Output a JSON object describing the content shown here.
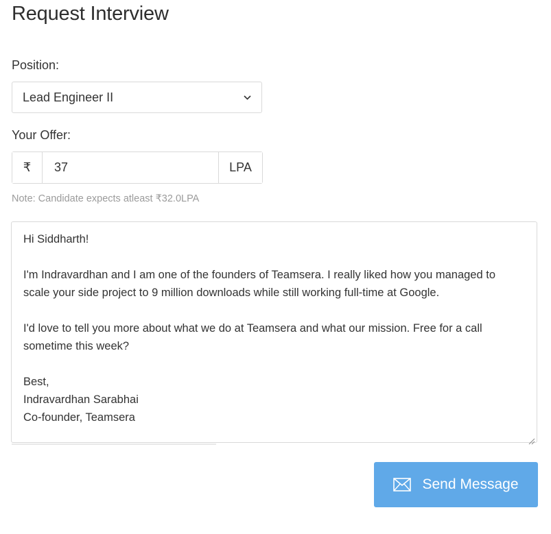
{
  "page": {
    "title": "Request Interview"
  },
  "form": {
    "position_label": "Position:",
    "position_value": "Lead Engineer II",
    "offer_label": "Your Offer:",
    "currency_symbol": "₹",
    "offer_value": "37",
    "offer_unit": "LPA",
    "note": "Note: Candidate expects atleast ₹32.0LPA"
  },
  "message": {
    "lines": [
      "Hi Siddharth!",
      "",
      "I'm Indravardhan and I am one of the founders of Teamsera. I really liked how you managed to",
      "scale your side project to 9 million downloads while still working full-time at Google.",
      "",
      "I'd love to tell you more about what we do at Teamsera and what our mission. Free for a call",
      "sometime this week?",
      "",
      "Best,",
      "Indravardhan Sarabhai",
      "Co-founder, Teamsera"
    ]
  },
  "actions": {
    "send_label": "Send Message"
  },
  "icons": {
    "select_arrow": "chevron-down-icon",
    "send": "envelope-icon",
    "resize": "resize-grip-icon"
  },
  "colors": {
    "accent": "#60a9e8",
    "border": "#d9d9d9",
    "note": "#9b9b9b"
  }
}
